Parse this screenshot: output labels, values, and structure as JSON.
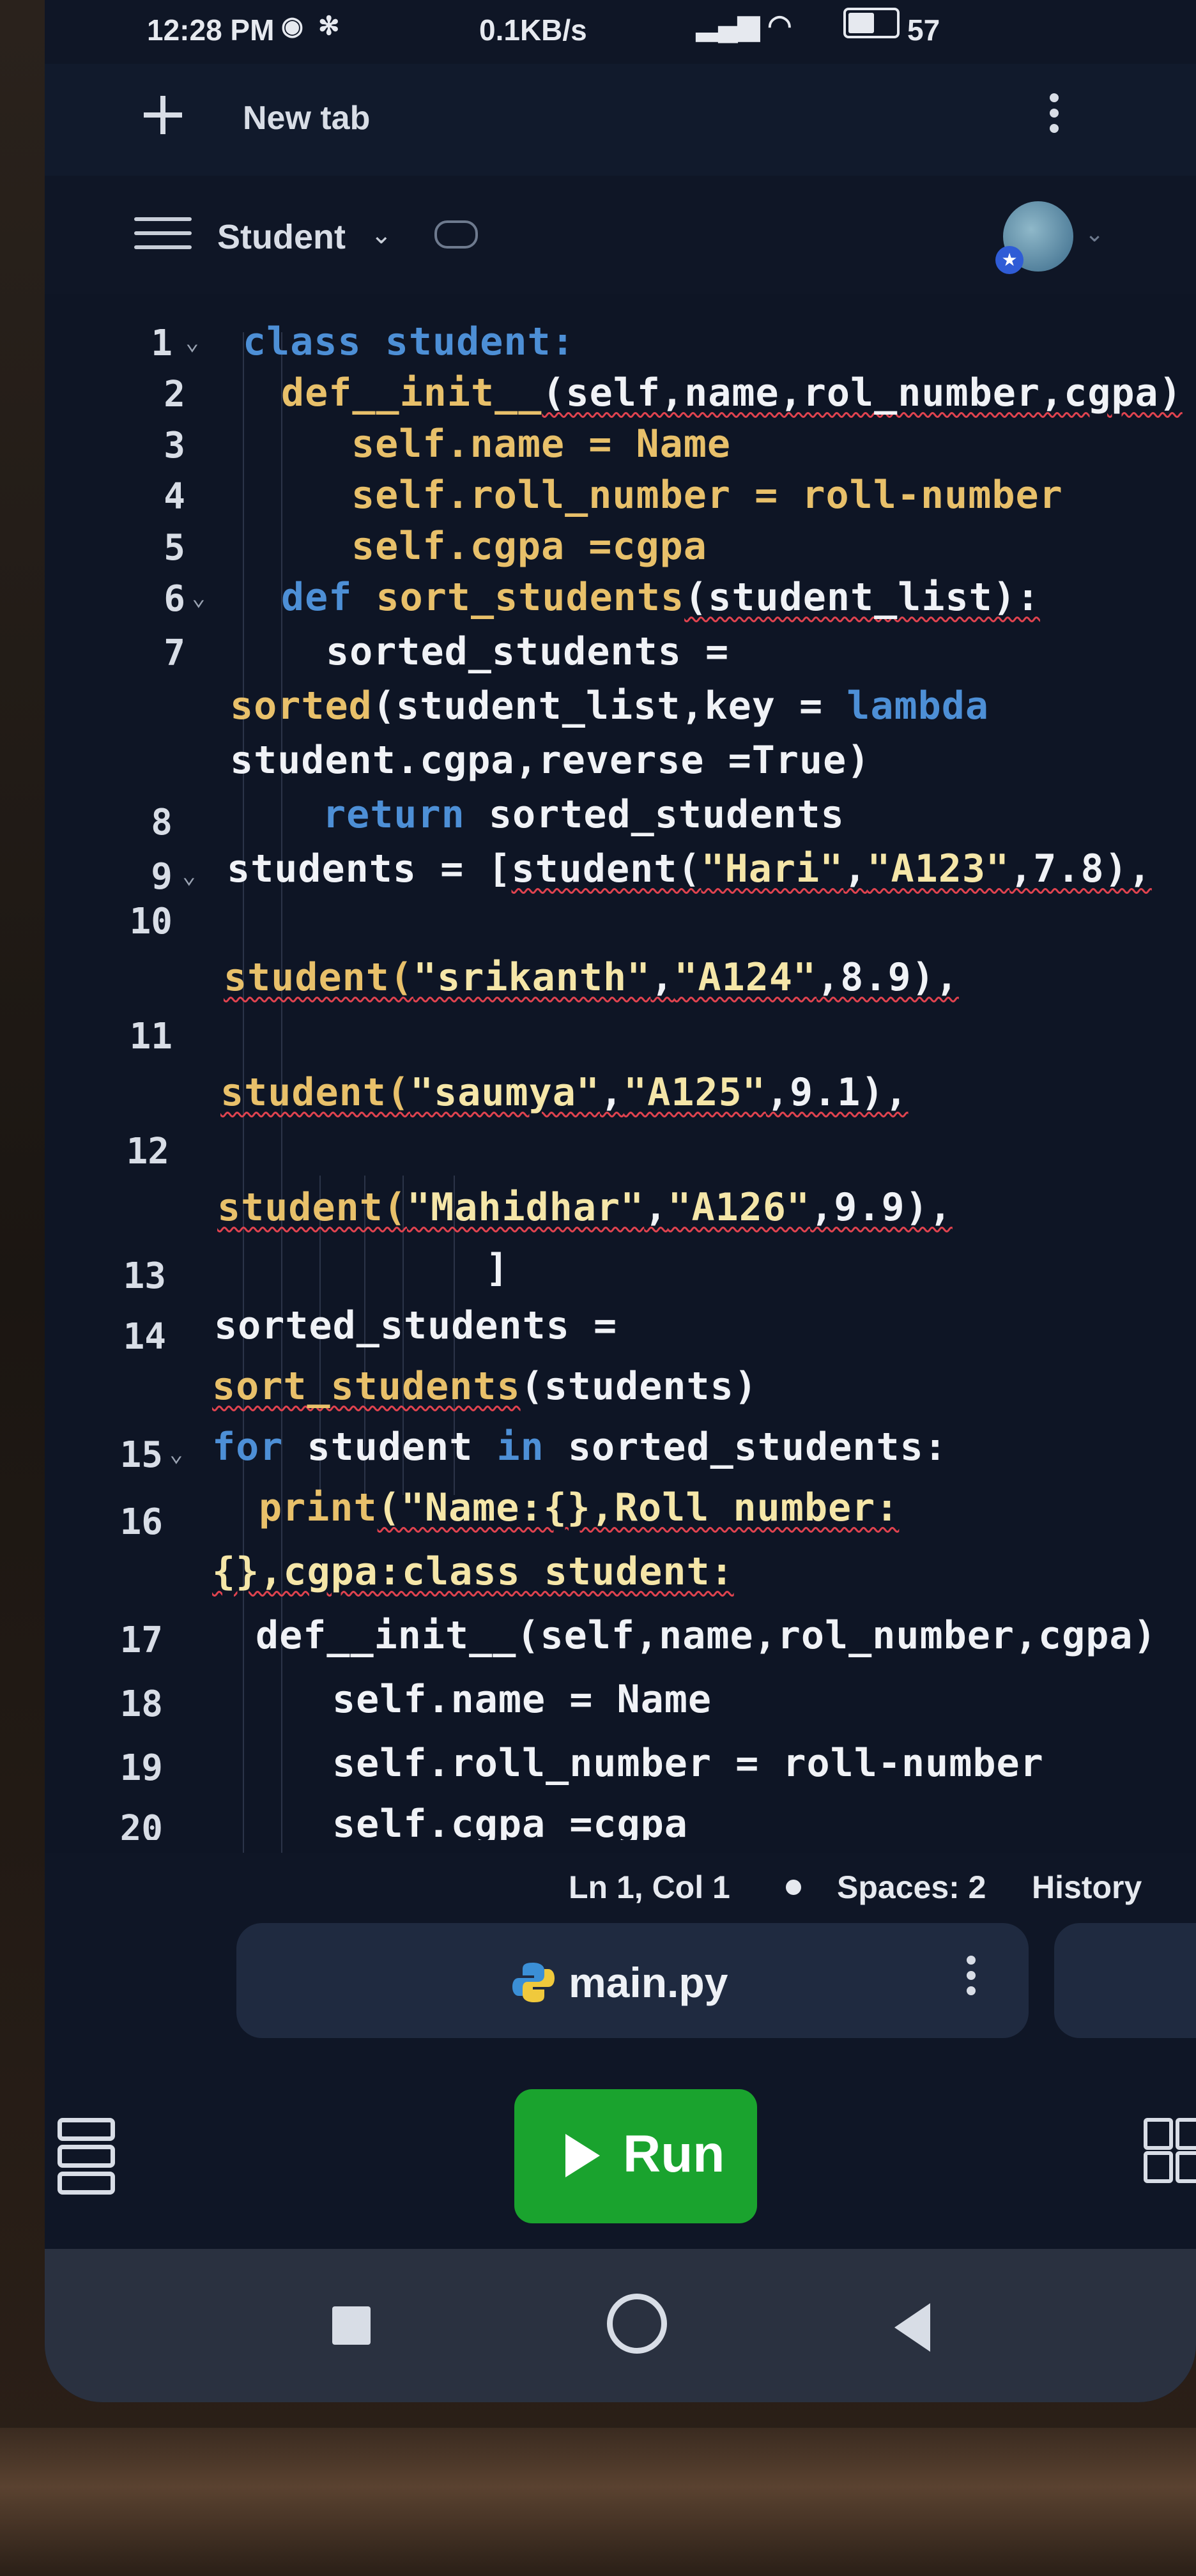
{
  "status_bar": {
    "time": "12:28 PM",
    "network_speed": "0.1KB/s",
    "battery": "57"
  },
  "tab_bar": {
    "title": "New tab"
  },
  "repl_header": {
    "name": "Student"
  },
  "code_lines": [
    {
      "num": "1",
      "fold": true
    },
    {
      "num": "2",
      "fold": false
    },
    {
      "num": "3",
      "fold": false
    },
    {
      "num": "4",
      "fold": false
    },
    {
      "num": "5",
      "fold": false
    },
    {
      "num": "6",
      "fold": true
    },
    {
      "num": "7",
      "fold": false
    },
    {
      "num": "8",
      "fold": false
    },
    {
      "num": "9",
      "fold": true
    },
    {
      "num": "10",
      "fold": false
    },
    {
      "num": "11",
      "fold": false
    },
    {
      "num": "12",
      "fold": false
    },
    {
      "num": "13",
      "fold": false
    },
    {
      "num": "14",
      "fold": false
    },
    {
      "num": "15",
      "fold": true
    },
    {
      "num": "16",
      "fold": false
    },
    {
      "num": "17",
      "fold": false
    },
    {
      "num": "18",
      "fold": false
    },
    {
      "num": "19",
      "fold": false
    },
    {
      "num": "20",
      "fold": false
    }
  ],
  "code": {
    "l1_kw": "class",
    "l1_rest": " student:",
    "l2_kw": "def",
    "l2_fn": "__init__",
    "l2_rest": "(self,name,rol_number,cgpa)",
    "l3": "self.name = Name",
    "l4": "self.roll_number = roll-number",
    "l5": "self.cgpa =cgpa",
    "l6_kw": "def",
    "l6_fn": " sort_students",
    "l6_rest": "(student_list):",
    "l7a": "sorted_students =",
    "l7b_fn": "sorted",
    "l7b_rest": "(student_list,key = ",
    "l7b_kw": "lambda",
    "l7c": "student.cgpa,reverse =True)",
    "l8_kw": "return",
    "l8_rest": " sorted_students",
    "l9_a": "students = [",
    "l9_b": "student(",
    "l9_s1": "\"Hari\"",
    "l9_c": ",",
    "l9_s2": "\"A123\"",
    "l9_d": ",7.8),",
    "l10_a": "student(",
    "l10_s1": "\"srikanth\"",
    "l10_b": ",",
    "l10_s2": "\"A124\"",
    "l10_c": ",8.9),",
    "l11_a": "student(",
    "l11_s1": "\"saumya\"",
    "l11_b": ",",
    "l11_s2": "\"A125\"",
    "l11_c": ",9.1),",
    "l12_a": "student(",
    "l12_s1": "\"Mahidhar\"",
    "l12_b": ",",
    "l12_s2": "\"A126\"",
    "l12_c": ",9.9),",
    "l13": "]",
    "l14a": "sorted_students =",
    "l14b_fn": "sort_students",
    "l14b_rest": "(students)",
    "l15_kw1": "for",
    "l15_a": " student ",
    "l15_kw2": "in",
    "l15_b": " sorted_students:",
    "l16a_fn": "print",
    "l16a_rest": "(\"Name:{},Roll number:",
    "l16b": "{},cgpa:class student:",
    "l17": "def__init__(self,name,rol_number,cgpa)",
    "l18": "self.name = Name",
    "l19": "self.roll_number = roll-number",
    "l20": "self.cgpa =cgpa"
  },
  "editor_status": {
    "position": "Ln 1, Col 1",
    "spaces": "Spaces: 2",
    "history": "History"
  },
  "file_tab": {
    "name": "main.py"
  },
  "toolbar": {
    "run_label": "Run"
  },
  "colors": {
    "keyword": "#4d8fd6",
    "function": "#e8c06a",
    "string": "#f5e6a8",
    "run_button": "#1aa32e",
    "background": "#0e1525"
  },
  "icons": [
    "plus-icon",
    "kebab-menu-icon",
    "hamburger-icon",
    "chevron-down-icon",
    "cloud-icon",
    "python-icon",
    "tools-icon",
    "grid-icon",
    "play-icon"
  ]
}
